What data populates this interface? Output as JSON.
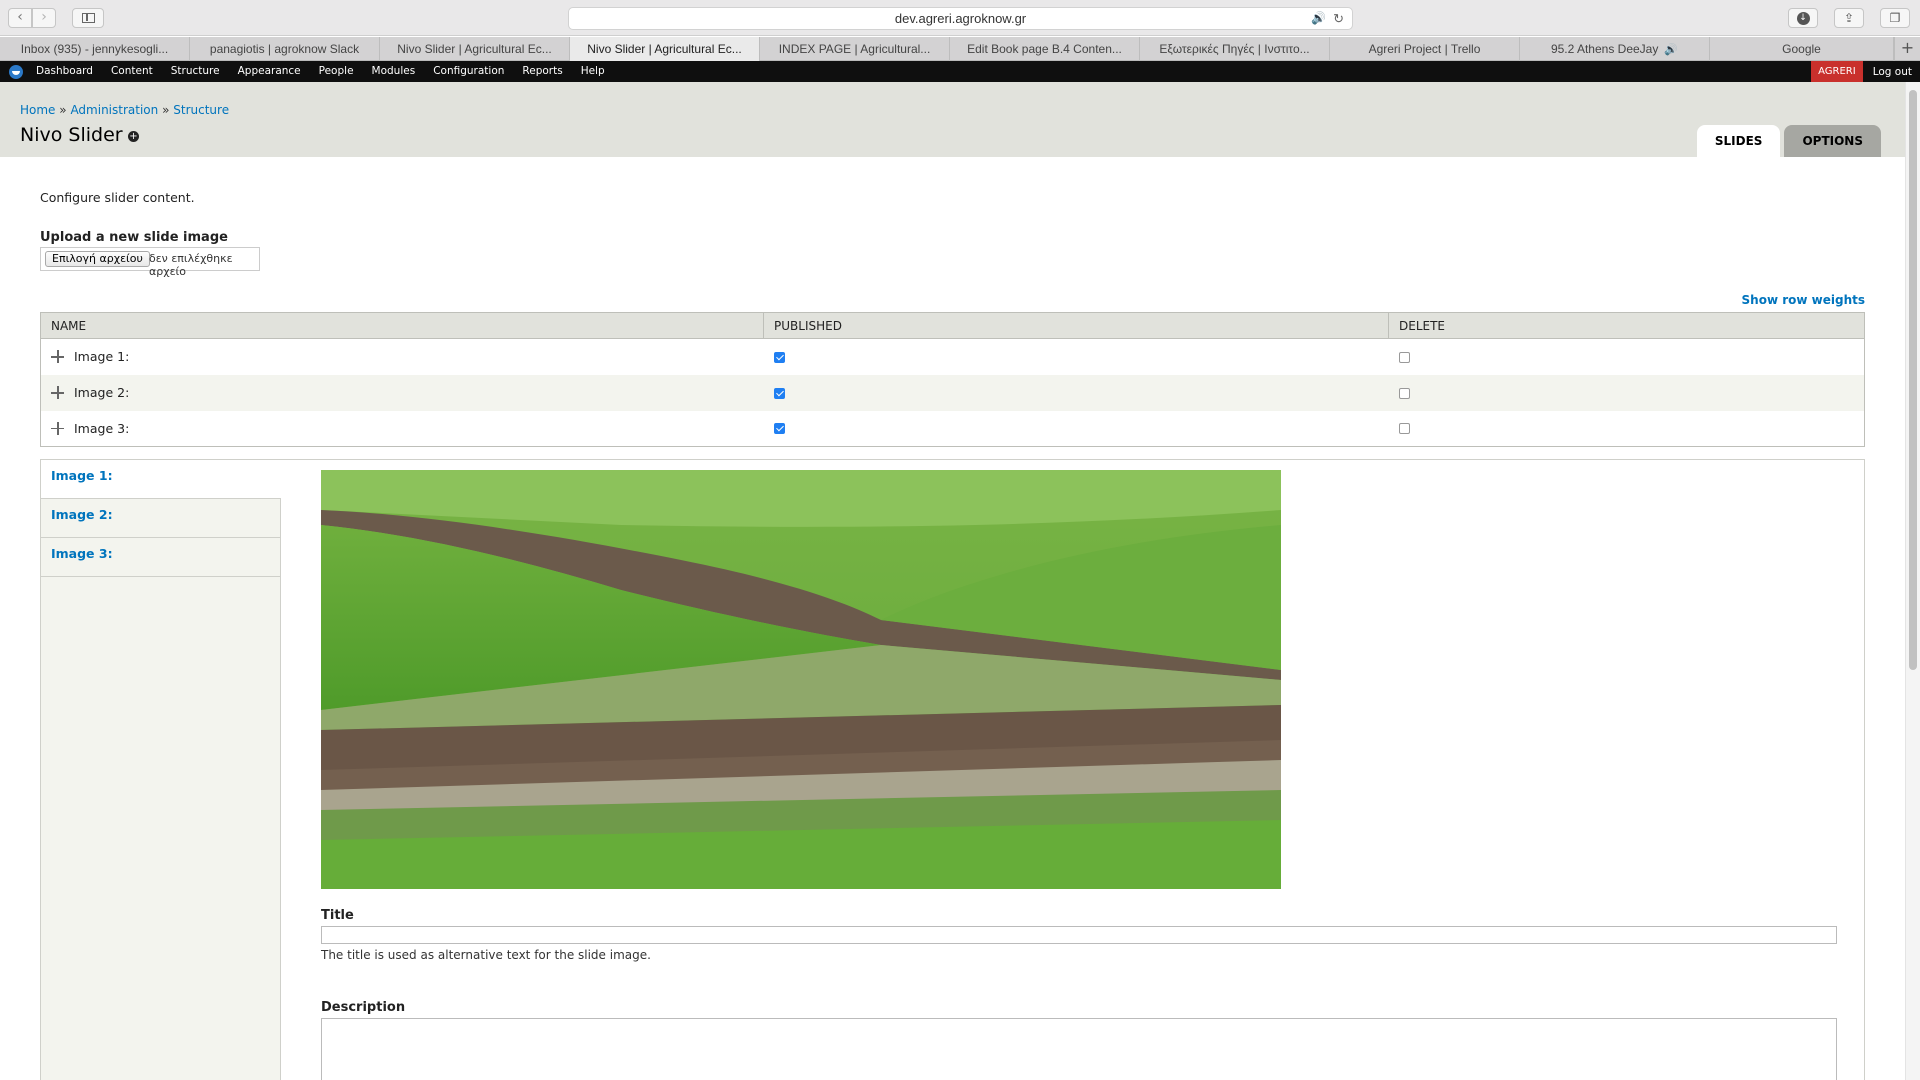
{
  "browser": {
    "url": "dev.agreri.agroknow.gr",
    "tabs": [
      {
        "label": "Inbox (935) - jennykesogli..."
      },
      {
        "label": "panagiotis | agroknow Slack"
      },
      {
        "label": "Nivo Slider | Agricultural Ec..."
      },
      {
        "label": "Nivo Slider | Agricultural Ec..."
      },
      {
        "label": "INDEX PAGE | Agricultural..."
      },
      {
        "label": "Edit Book page B.4 Conten..."
      },
      {
        "label": "Εξωτερικές Πηγές | Ινστιτο..."
      },
      {
        "label": "Agreri Project | Trello"
      },
      {
        "label": "95.2 Athens DeeJay"
      },
      {
        "label": "Google"
      }
    ]
  },
  "admin_toolbar": {
    "items": [
      "Dashboard",
      "Content",
      "Structure",
      "Appearance",
      "People",
      "Modules",
      "Configuration",
      "Reports",
      "Help"
    ],
    "user": "AGRERI",
    "logout": "Log out"
  },
  "header": {
    "breadcrumb": [
      "Home",
      "Administration",
      "Structure"
    ],
    "separator": "»",
    "title": "Nivo Slider",
    "tabs": [
      "SLIDES",
      "OPTIONS"
    ]
  },
  "content": {
    "intro": "Configure slider content.",
    "upload_label": "Upload a new slide image",
    "file_button": "Επιλογή αρχείου",
    "file_status": "δεν επιλέχθηκε αρχείο",
    "show_row_weights": "Show row weights",
    "table": {
      "columns": [
        "NAME",
        "PUBLISHED",
        "DELETE"
      ],
      "rows": [
        {
          "name": "Image 1:",
          "published": true,
          "delete": false
        },
        {
          "name": "Image 2:",
          "published": true,
          "delete": false
        },
        {
          "name": "Image 3:",
          "published": true,
          "delete": false
        }
      ]
    },
    "vertical_tabs": [
      "Image 1:",
      "Image 2:",
      "Image 3:"
    ],
    "fields": {
      "title_label": "Title",
      "title_help": "The title is used as alternative text for the slide image.",
      "description_label": "Description"
    }
  },
  "colors": {
    "admin_bar": "#0f0f0f",
    "link": "#0074bd",
    "header_bg": "#e1e2dc",
    "user_badge": "#c9302c",
    "checkbox_on": "#1f7ff2"
  },
  "icons": [
    "back-icon",
    "forward-icon",
    "sidebar-icon",
    "audio-icon",
    "reload-icon",
    "download-icon",
    "share-icon",
    "tabs-overview-icon",
    "drupal-logo-icon",
    "add-shortcut-icon",
    "drag-handle-icon"
  ]
}
